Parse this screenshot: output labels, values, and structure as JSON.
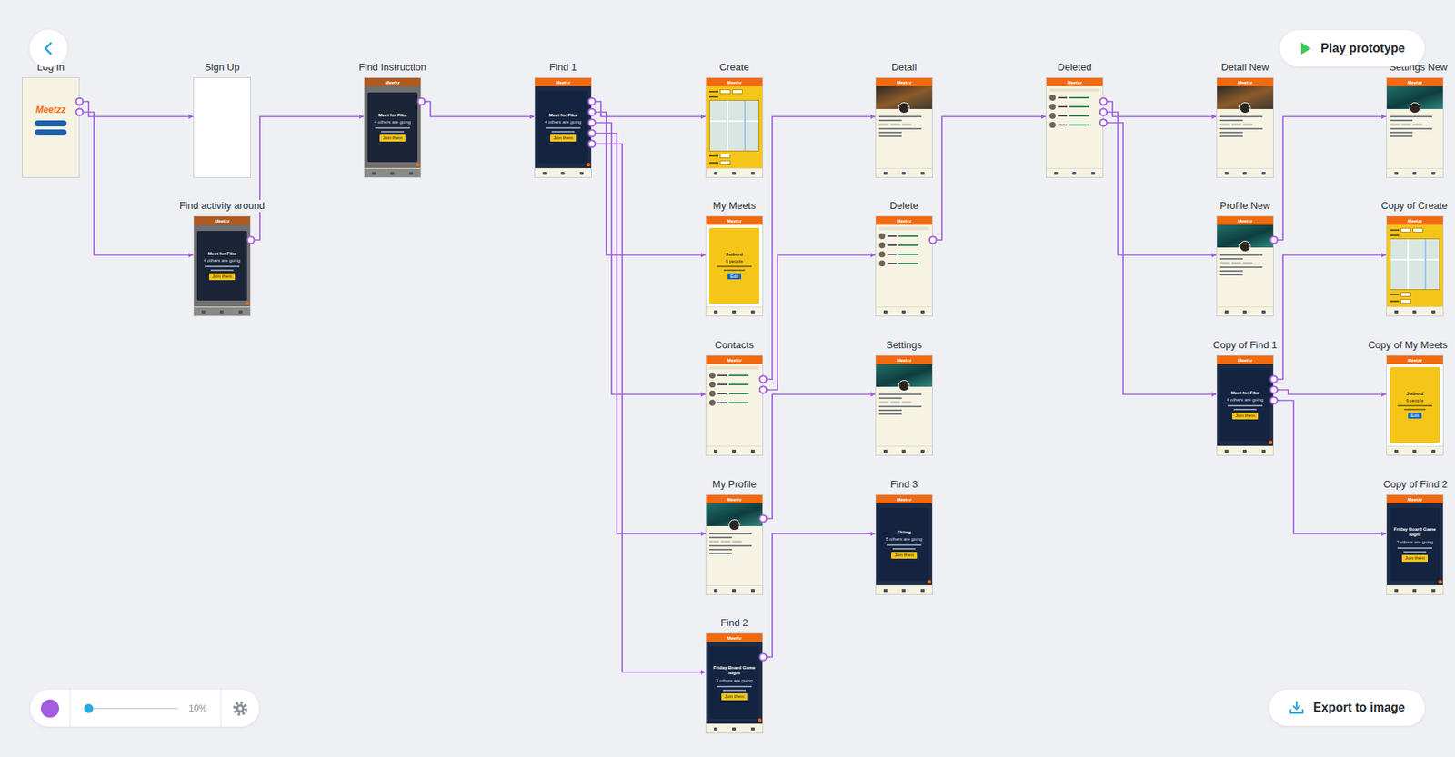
{
  "toolbar": {
    "play_button": "Play prototype",
    "export_button": "Export to image",
    "zoom": {
      "reading": "10%",
      "level": 0.05
    }
  },
  "nodes": [
    {
      "label": "Log In",
      "kind": "login",
      "logo": "Meetzz"
    },
    {
      "label": "Sign Up",
      "kind": "blank"
    },
    {
      "label": "Find activity around",
      "kind": "overlay",
      "logo": "Meetzz",
      "title": "Meet for Fika",
      "subtitle": "4 others are going",
      "button": "Join them"
    },
    {
      "label": "Find Instruction",
      "kind": "overlay",
      "logo": "Meetzz",
      "title": "Meet for Fika",
      "subtitle": "4 others are going",
      "button": "Join them"
    },
    {
      "label": "Find 1",
      "kind": "find",
      "logo": "Meetzz",
      "title": "Meet for Fika",
      "subtitle": "4 others are going",
      "button": "Join them"
    },
    {
      "label": "Create",
      "kind": "create",
      "logo": "Meetzz"
    },
    {
      "label": "My Meets",
      "kind": "meets",
      "logo": "Meetzz",
      "title": "Jutbord",
      "subtitle": "6 people",
      "button": "Edit"
    },
    {
      "label": "Contacts",
      "kind": "list",
      "logo": "Meetzz"
    },
    {
      "label": "My Profile",
      "kind": "profile",
      "logo": "Meetzz"
    },
    {
      "label": "Find 2",
      "kind": "find",
      "logo": "Meetzz",
      "title": "Friday Board Game Night",
      "subtitle": "3 others are going",
      "button": "Join them"
    },
    {
      "label": "Detail",
      "kind": "detail",
      "logo": "Meetzz"
    },
    {
      "label": "Delete",
      "kind": "list",
      "logo": "Meetzz"
    },
    {
      "label": "Settings",
      "kind": "profile",
      "logo": "Meetzz"
    },
    {
      "label": "Find 3",
      "kind": "find",
      "logo": "Meetzz",
      "title": "Skiing",
      "subtitle": "5 others are going",
      "button": "Join them"
    },
    {
      "label": "Deleted",
      "kind": "list",
      "logo": "Meetzz"
    },
    {
      "label": "Detail New",
      "kind": "detail",
      "logo": "Meetzz"
    },
    {
      "label": "Profile New",
      "kind": "profile",
      "logo": "Meetzz"
    },
    {
      "label": "Copy of Find 1",
      "kind": "find",
      "logo": "Meetzz",
      "title": "Meet for Fika",
      "subtitle": "4 others are going",
      "button": "Join them"
    },
    {
      "label": "Settings New",
      "kind": "profile",
      "logo": "Meetzz"
    },
    {
      "label": "Copy of Create",
      "kind": "create",
      "logo": "Meetzz"
    },
    {
      "label": "Copy of My Meets",
      "kind": "meets",
      "logo": "Meetzz",
      "title": "Jutbord",
      "subtitle": "6 people",
      "button": "Edit"
    },
    {
      "label": "Copy of Find 2",
      "kind": "find",
      "logo": "Meetzz",
      "title": "Friday Board Game Night",
      "subtitle": "3 others are going",
      "button": "Join them"
    }
  ],
  "links": [
    {
      "from": "Log In",
      "to": "Sign Up"
    },
    {
      "from": "Log In",
      "to": "Find activity around"
    },
    {
      "from": "Find activity around",
      "to": "Find Instruction"
    },
    {
      "from": "Find Instruction",
      "to": "Find 1"
    },
    {
      "from": "Find 1",
      "to": "Create"
    },
    {
      "from": "Find 1",
      "to": "My Meets"
    },
    {
      "from": "Find 1",
      "to": "Contacts"
    },
    {
      "from": "Find 1",
      "to": "My Profile"
    },
    {
      "from": "Find 1",
      "to": "Find 2"
    },
    {
      "from": "Contacts",
      "to": "Detail"
    },
    {
      "from": "Contacts",
      "to": "Delete"
    },
    {
      "from": "Delete",
      "to": "Deleted"
    },
    {
      "from": "My Profile",
      "to": "Settings"
    },
    {
      "from": "Find 2",
      "to": "Find 3"
    },
    {
      "from": "Deleted",
      "to": "Detail New"
    },
    {
      "from": "Deleted",
      "to": "Profile New"
    },
    {
      "from": "Deleted",
      "to": "Copy of Find 1"
    },
    {
      "from": "Profile New",
      "to": "Settings New"
    },
    {
      "from": "Copy of Find 1",
      "to": "Copy of Create"
    },
    {
      "from": "Copy of Find 1",
      "to": "Copy of My Meets"
    },
    {
      "from": "Copy of Find 1",
      "to": "Copy of Find 2"
    }
  ]
}
